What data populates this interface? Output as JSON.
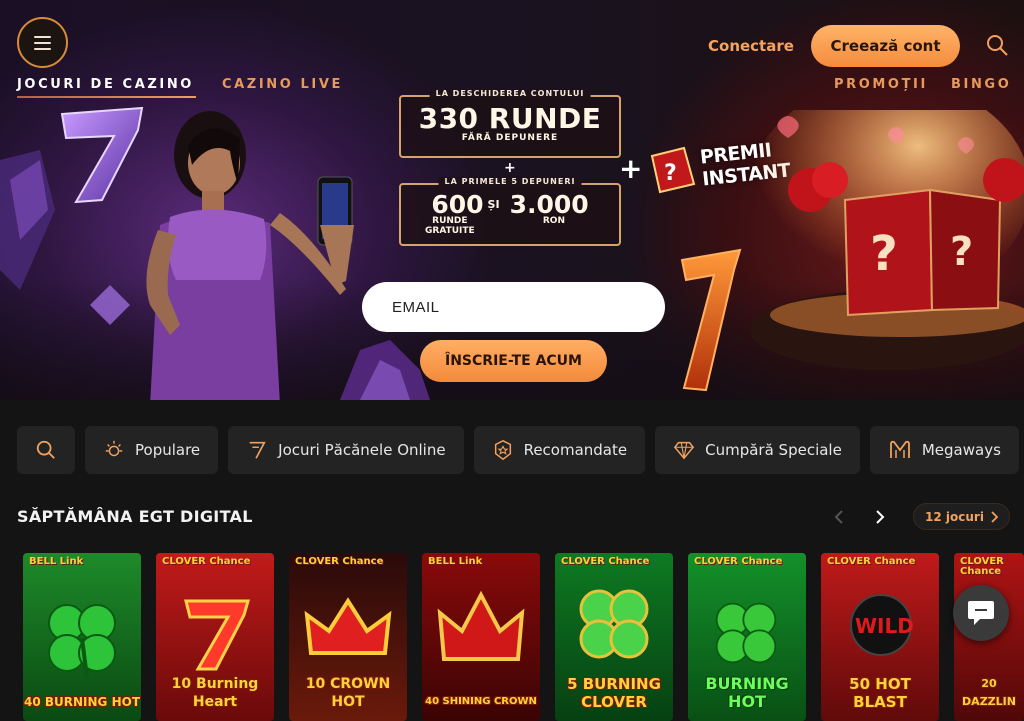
{
  "header": {
    "menu_icon": "hamburger-icon",
    "nav": [
      "JOCURI DE CAZINO",
      "CAZINO LIVE"
    ],
    "nav_right": [
      "PROMOȚII",
      "BINGO"
    ],
    "login_label": "Conectare",
    "signup_label": "Creează cont",
    "search_icon": "search-icon"
  },
  "hero": {
    "offer1_caption": "LA DESCHIDEREA CONTULUI",
    "offer1_big": "330 RUNDE",
    "offer1_small": "FĂRĂ DEPUNERE",
    "plus": "+",
    "offer2_caption": "LA PRIMELE 5 DEPUNERI",
    "offer2_left_num": "600",
    "offer2_left_lbl1": "RUNDE",
    "offer2_left_lbl2": "GRATUITE",
    "offer2_mid": "ȘI",
    "offer2_right_num": "3.000",
    "offer2_right_lbl": "RON",
    "bonus_plus": "+",
    "bonus_line1": "PREMII",
    "bonus_line2": "INSTANT",
    "email_placeholder": "EMAIL",
    "join_label": "ÎNSCRIE-TE ACUM"
  },
  "categories": [
    {
      "label": "",
      "icon": "search-icon"
    },
    {
      "label": "Populare",
      "icon": "sun-icon"
    },
    {
      "label": "Jocuri Păcănele Online",
      "icon": "seven-icon"
    },
    {
      "label": "Recomandate",
      "icon": "star-badge-icon"
    },
    {
      "label": "Cumpără Speciale",
      "icon": "diamond-icon"
    },
    {
      "label": "Megaways",
      "icon": "megaways-icon"
    }
  ],
  "section": {
    "title": "SĂPTĂMÂNA EGT DIGITAL",
    "count_label": "12 jocuri"
  },
  "games": [
    {
      "badge": "BELL Link",
      "name": "40 BURNING HOT"
    },
    {
      "badge": "CLOVER Chance",
      "name": "10 Burning Heart"
    },
    {
      "badge": "CLOVER Chance",
      "name": "10 CROWN HOT"
    },
    {
      "badge": "BELL Link",
      "name": "40 SHINING CROWN"
    },
    {
      "badge": "CLOVER Chance",
      "name": "5 BURNING CLOVER"
    },
    {
      "badge": "CLOVER Chance",
      "name": "BURNING HOT"
    },
    {
      "badge": "CLOVER Chance",
      "name": "50 HOT BLAST"
    },
    {
      "badge": "CLOVER Chance",
      "name": "20 DAZZLIN"
    }
  ],
  "colors": {
    "accent": "#f48c3c",
    "accent_light": "#ffb36a",
    "bg": "#141414",
    "card": "#232323"
  }
}
